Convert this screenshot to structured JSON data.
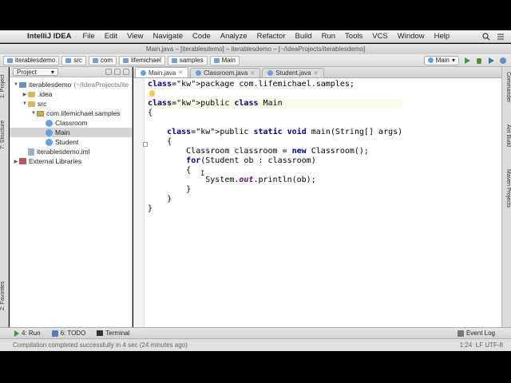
{
  "menubar": {
    "app_name": "IntelliJ IDEA",
    "items": [
      "File",
      "Edit",
      "View",
      "Navigate",
      "Code",
      "Analyze",
      "Refactor",
      "Build",
      "Run",
      "Tools",
      "VCS",
      "Window",
      "Help"
    ]
  },
  "window": {
    "title": "Main.java – [iterablesdemo] – iterablesdemo – [~/IdeaProjects/iterablesdemo]"
  },
  "navbar": {
    "crumbs": [
      "iterablesdemo",
      "src",
      "com",
      "lifemichael",
      "samples",
      "Main"
    ],
    "run_config": "Main"
  },
  "left_strip": {
    "project_tab": "1: Project",
    "structure_tab": "7: Structure",
    "favorites_tab": "2: Favorites"
  },
  "project_panel": {
    "selector": "Project",
    "tree": [
      {
        "label": "iterablesdemo",
        "hint": "(~/IdeaProjects/ite",
        "level": 0,
        "icon": "module-folder-icon",
        "arrow": "▼"
      },
      {
        "label": ".idea",
        "hint": "",
        "level": 1,
        "icon": "folder-icon",
        "arrow": "▶"
      },
      {
        "label": "src",
        "hint": "",
        "level": 1,
        "icon": "folder-icon",
        "arrow": "▼"
      },
      {
        "label": "com.lifemichael.samples",
        "hint": "",
        "level": 2,
        "icon": "package-icon",
        "arrow": "▼"
      },
      {
        "label": "Classroom",
        "hint": "",
        "level": 3,
        "icon": "class-icon",
        "arrow": ""
      },
      {
        "label": "Main",
        "hint": "",
        "level": 3,
        "icon": "class-icon",
        "arrow": "",
        "selected": true
      },
      {
        "label": "Student",
        "hint": "",
        "level": 3,
        "icon": "class-icon",
        "arrow": ""
      },
      {
        "label": "iterablesdemo.iml",
        "hint": "",
        "level": 1,
        "icon": "iml-file-icon",
        "arrow": ""
      },
      {
        "label": "External Libraries",
        "hint": "",
        "level": 0,
        "icon": "library-icon",
        "arrow": "▶"
      }
    ]
  },
  "editor": {
    "tabs": [
      {
        "label": "Main.java",
        "active": true
      },
      {
        "label": "Classroom.java",
        "active": false
      },
      {
        "label": "Student.java",
        "active": false
      }
    ],
    "code_lines": [
      "package com.lifemichael.samples;",
      "",
      "public class Main",
      "{",
      "",
      "    public static void main(String[] args)",
      "    {",
      "        Classroom classroom = new Classroom();",
      "        for(Student ob : classroom)",
      "        {",
      "            System.out.println(ob);",
      "        }",
      "    }",
      "}"
    ]
  },
  "right_strip": {
    "commander_tab": "Commander",
    "ant_tab": "Ant Build",
    "maven_tab": "Maven Projects"
  },
  "bottom_toolbar": {
    "run": "4: Run",
    "todo": "6: TODO",
    "terminal": "Terminal",
    "event_log": "Event Log"
  },
  "status": {
    "message": "Compilation completed successfully in 4 sec (24 minutes ago)",
    "position": "1:24",
    "encoding": "LF  UTF-8"
  }
}
